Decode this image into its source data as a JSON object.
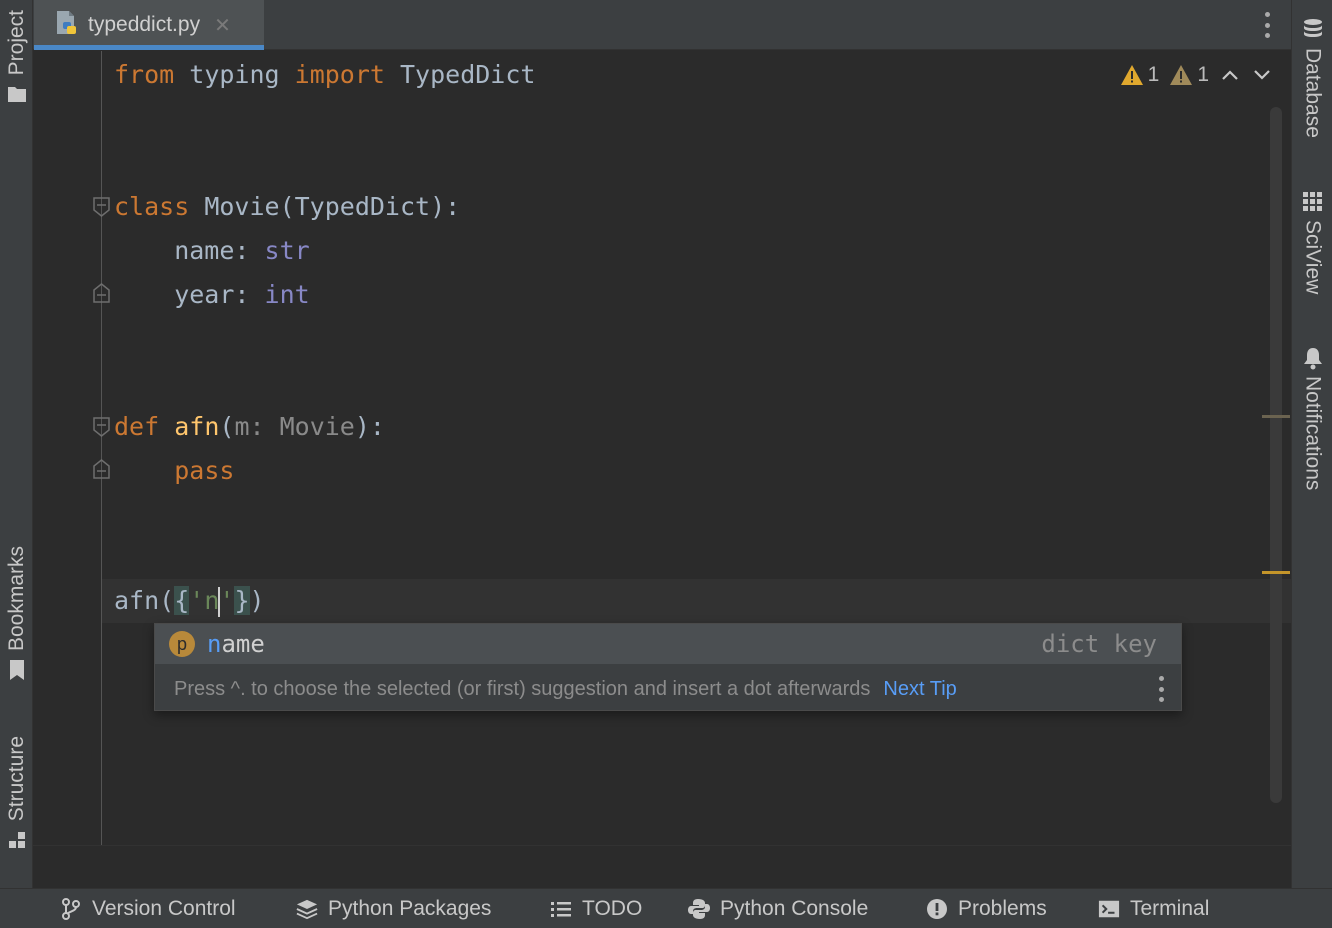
{
  "tab": {
    "title": "typeddict.py",
    "close": "✕"
  },
  "left_tools": {
    "project": "Project",
    "bookmarks": "Bookmarks",
    "structure": "Structure"
  },
  "right_tools": {
    "database": "Database",
    "sciview": "SciView",
    "notifications": "Notifications"
  },
  "inspection": {
    "warnings": "1",
    "weak_warnings": "1"
  },
  "code": {
    "l1": {
      "kw1": "from",
      "mod": " typing ",
      "kw2": "import",
      "name": " TypedDict"
    },
    "l2": {
      "kw": "class",
      "rest": " Movie(TypedDict):"
    },
    "l3": {
      "field": "    name: ",
      "type": "str"
    },
    "l4": {
      "field": "    year: ",
      "type": "int"
    },
    "l5": {
      "kw": "def",
      "space": " ",
      "fn": "afn",
      "open": "(",
      "param": "m: Movie",
      "close": "):"
    },
    "l6": {
      "indent": "    ",
      "kw": "pass"
    },
    "l7": {
      "prefix": "afn(",
      "brace_open": "{",
      "str_open": "'n",
      "str_close": "'",
      "brace_close": "}",
      "suffix": ")"
    }
  },
  "completion": {
    "icon_letter": "p",
    "match": "n",
    "rest": "ame",
    "type": "dict key",
    "hint": "Press ^. to choose the selected (or first) suggestion and insert a dot afterwards",
    "next_tip": "Next Tip"
  },
  "bottom_tools": {
    "version_control": "Version Control",
    "python_packages": "Python Packages",
    "todo": "TODO",
    "python_console": "Python Console",
    "problems": "Problems",
    "terminal": "Terminal"
  },
  "colors": {
    "warning": "#e0a82e",
    "weak_warning": "#a08a5a",
    "accent": "#4a88c7",
    "link": "#589df6",
    "keyword": "#cc7832",
    "function": "#ffc66d"
  }
}
